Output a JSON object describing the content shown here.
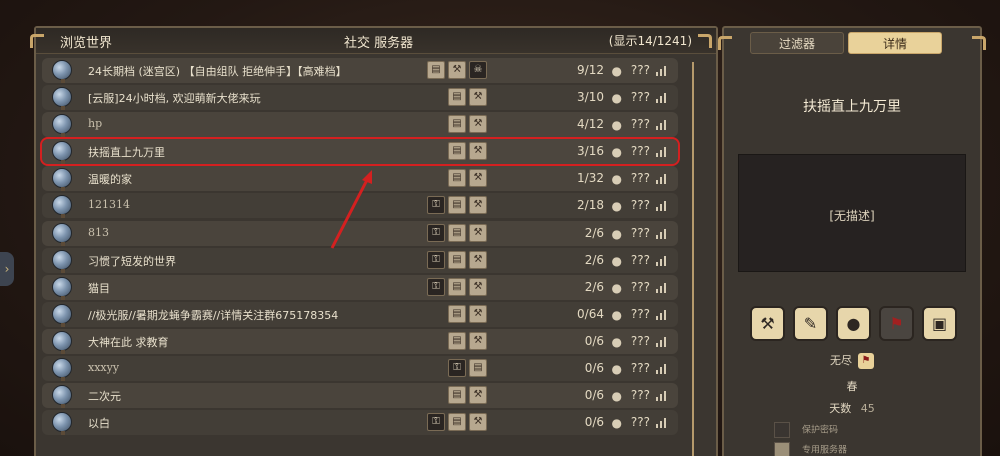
{
  "header": {
    "left_title": "浏览世界",
    "center_title": "社交 服务器",
    "count": "(显示14/1241)"
  },
  "servers": [
    {
      "name": "24长期档 (迷宫区) 【自由组队 拒绝伸手】【高难档】",
      "players": "9/12",
      "ping": "???",
      "icons": [
        "scroll",
        "bone",
        "skull"
      ],
      "serif": false
    },
    {
      "name": "[云服]24小时档, 欢迎萌新大佬来玩",
      "players": "3/10",
      "ping": "???",
      "icons": [
        "scroll",
        "bone"
      ],
      "serif": false
    },
    {
      "name": "hp",
      "players": "4/12",
      "ping": "???",
      "icons": [
        "scroll",
        "bone"
      ],
      "serif": true
    },
    {
      "name": "扶摇直上九万里",
      "players": "3/16",
      "ping": "???",
      "icons": [
        "scroll",
        "bone"
      ],
      "serif": false,
      "selected": true
    },
    {
      "name": "温暖的家",
      "players": "1/32",
      "ping": "???",
      "icons": [
        "scroll",
        "bone"
      ],
      "serif": false
    },
    {
      "name": "121314",
      "players": "2/18",
      "ping": "???",
      "icons": [
        "lock",
        "scroll",
        "bone"
      ],
      "serif": true
    },
    {
      "name": "813",
      "players": "2/6",
      "ping": "???",
      "icons": [
        "lock",
        "scroll",
        "bone"
      ],
      "serif": true
    },
    {
      "name": "习惯了短发的世界",
      "players": "2/6",
      "ping": "???",
      "icons": [
        "lock",
        "scroll",
        "bone"
      ],
      "serif": false
    },
    {
      "name": "猫目",
      "players": "2/6",
      "ping": "???",
      "icons": [
        "lock",
        "scroll",
        "bone"
      ],
      "serif": false
    },
    {
      "name": "//极光服//暑期龙蝇争霸赛//详情关注群675178354",
      "players": "0/64",
      "ping": "???",
      "icons": [
        "scroll",
        "bone"
      ],
      "serif": false
    },
    {
      "name": "大神在此 求教育",
      "players": "0/6",
      "ping": "???",
      "icons": [
        "scroll",
        "bone"
      ],
      "serif": false
    },
    {
      "name": "xxxyy",
      "players": "0/6",
      "ping": "???",
      "icons": [
        "lock",
        "scroll"
      ],
      "serif": true
    },
    {
      "name": "二次元",
      "players": "0/6",
      "ping": "???",
      "icons": [
        "scroll",
        "bone"
      ],
      "serif": false
    },
    {
      "name": "以白",
      "players": "0/6",
      "ping": "???",
      "icons": [
        "lock",
        "scroll",
        "bone"
      ],
      "serif": false
    }
  ],
  "details": {
    "tabs": [
      "过滤器",
      "详情"
    ],
    "active_tab": "详情",
    "server_name": "扶摇直上九万里",
    "description": "[无描述]",
    "mode": "无尽",
    "season": "春",
    "days_label": "天数",
    "days": "45",
    "password_label": "保护密码",
    "dedicated_label": "专用服务器"
  }
}
